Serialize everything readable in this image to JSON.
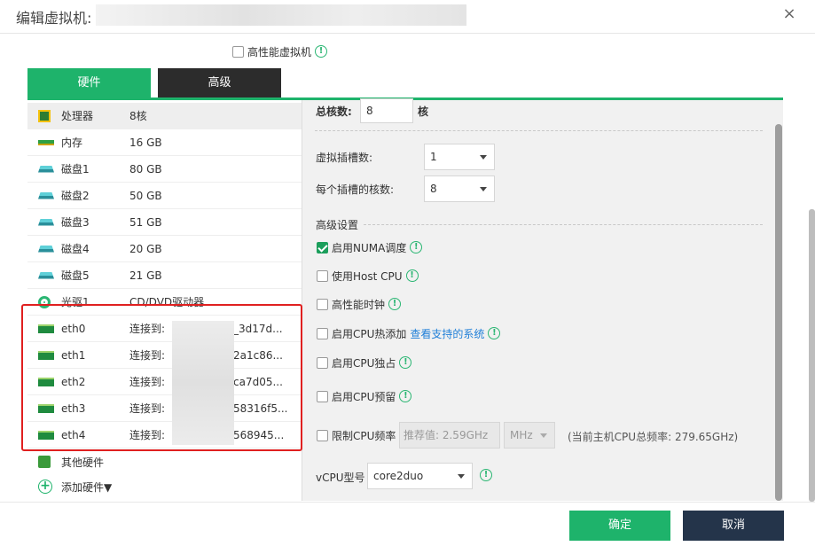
{
  "dialog": {
    "title": "编辑虚拟机:",
    "close_icon": "×"
  },
  "high_perf": {
    "label": "高性能虚拟机",
    "checked": false
  },
  "tabs": [
    {
      "label": "硬件",
      "active": true
    },
    {
      "label": "高级",
      "active": false
    }
  ],
  "hardware": [
    {
      "icon": "cpu-icon",
      "name": "处理器",
      "value": "8核"
    },
    {
      "icon": "memory-icon",
      "name": "内存",
      "value": "16 GB"
    },
    {
      "icon": "disk-icon",
      "name": "磁盘1",
      "value": "80 GB"
    },
    {
      "icon": "disk-icon",
      "name": "磁盘2",
      "value": "50 GB"
    },
    {
      "icon": "disk-icon",
      "name": "磁盘3",
      "value": "51 GB"
    },
    {
      "icon": "disk-icon",
      "name": "磁盘4",
      "value": "20 GB"
    },
    {
      "icon": "disk-icon",
      "name": "磁盘5",
      "value": "21 GB"
    },
    {
      "icon": "cdrom-icon",
      "name": "光驱1",
      "value": "CD/DVD驱动器"
    },
    {
      "icon": "nic-icon",
      "name": "eth0",
      "value": "连接到:",
      "suffix": "_3d17d..."
    },
    {
      "icon": "nic-icon",
      "name": "eth1",
      "value": "连接到:",
      "suffix": "2a1c86..."
    },
    {
      "icon": "nic-icon",
      "name": "eth2",
      "value": "连接到:",
      "suffix": "ca7d05..."
    },
    {
      "icon": "nic-icon",
      "name": "eth3",
      "value": "连接到:",
      "suffix": "58316f5..."
    },
    {
      "icon": "nic-icon",
      "name": "eth4",
      "value": "连接到:",
      "suffix": "568945..."
    },
    {
      "icon": "other-hardware-icon",
      "name": "其他硬件",
      "value": ""
    },
    {
      "icon": "add-icon",
      "name": "添加硬件▼",
      "value": ""
    }
  ],
  "cpu": {
    "total_cores_label": "总核数:",
    "total_cores_value": "8",
    "cores_unit": "核",
    "sockets_label": "虚拟插槽数:",
    "sockets_value": "1",
    "cores_per_socket_label": "每个插槽的核数:",
    "cores_per_socket_value": "8",
    "advanced_title": "高级设置",
    "options": [
      {
        "label": "启用NUMA调度",
        "checked": true,
        "info": true
      },
      {
        "label": "使用Host CPU",
        "checked": false,
        "info": true
      },
      {
        "label": "高性能时钟",
        "checked": false,
        "info": true
      },
      {
        "label": "启用CPU热添加",
        "checked": false,
        "info": true,
        "link": "查看支持的系统"
      },
      {
        "label": "启用CPU独占",
        "checked": false,
        "info": true
      },
      {
        "label": "启用CPU预留",
        "checked": false,
        "info": true
      }
    ],
    "limit_label": "限制CPU频率",
    "limit_placeholder": "推荐值: 2.59GHz",
    "limit_unit": "MHz",
    "limit_hint": "(当前主机CPU总频率: 279.65GHz)",
    "vcpu_label": "vCPU型号",
    "vcpu_value": "core2duo"
  },
  "footer": {
    "ok": "确定",
    "cancel": "取消"
  },
  "colors": {
    "accent": "#1eb36b",
    "dark": "#2c2c2c",
    "cancel": "#24344a",
    "highlight": "#e02020"
  }
}
